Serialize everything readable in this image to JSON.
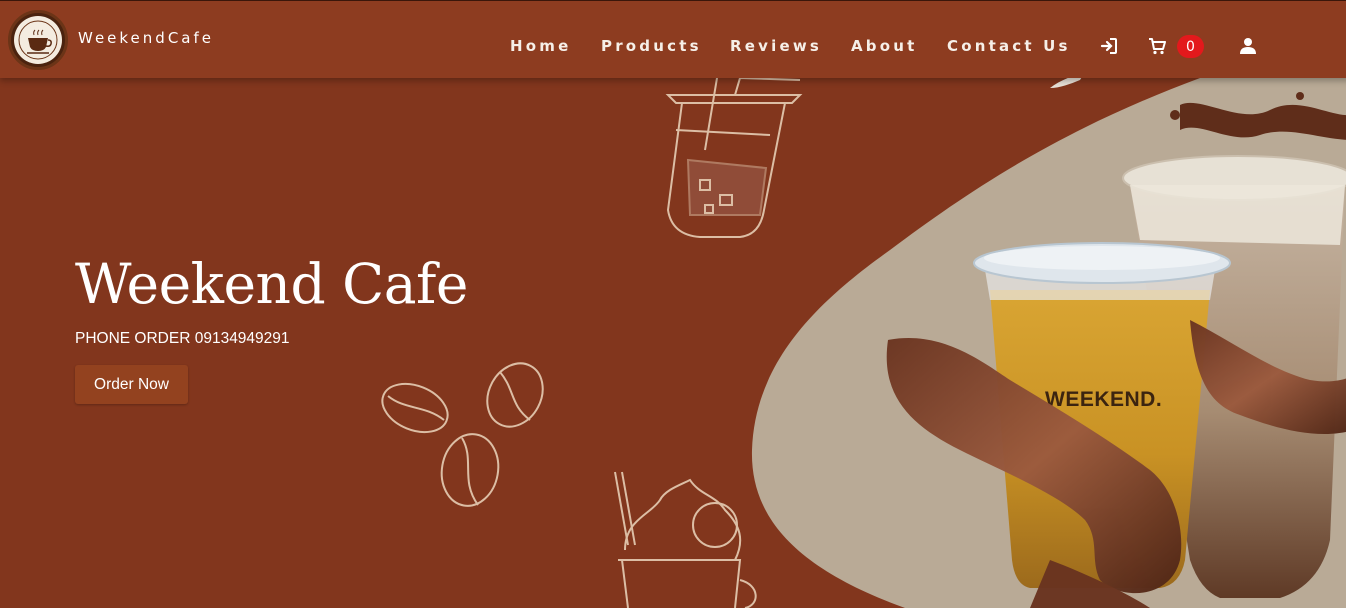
{
  "brand": {
    "name": "WeekendCafe",
    "logo_icon": "coffee-cup-icon",
    "logo_text": "WEEKEND CAFE"
  },
  "nav": {
    "items": [
      {
        "label": "Home"
      },
      {
        "label": "Products"
      },
      {
        "label": "Reviews"
      },
      {
        "label": "About"
      },
      {
        "label": "Contact Us"
      }
    ],
    "icons": [
      "sign-in-icon",
      "cart-icon",
      "user-icon"
    ],
    "cart_count": "0"
  },
  "hero": {
    "title": "Weekend Cafe",
    "phone": "PHONE ORDER 09134949291",
    "order_button": "Order Now",
    "cup_label": "WEEKEND."
  },
  "colors": {
    "navbar": "#8d3c20",
    "hero_background": "#82361d",
    "blob": "#b9aa96",
    "button": "#93421f",
    "badge": "#e3191c"
  }
}
